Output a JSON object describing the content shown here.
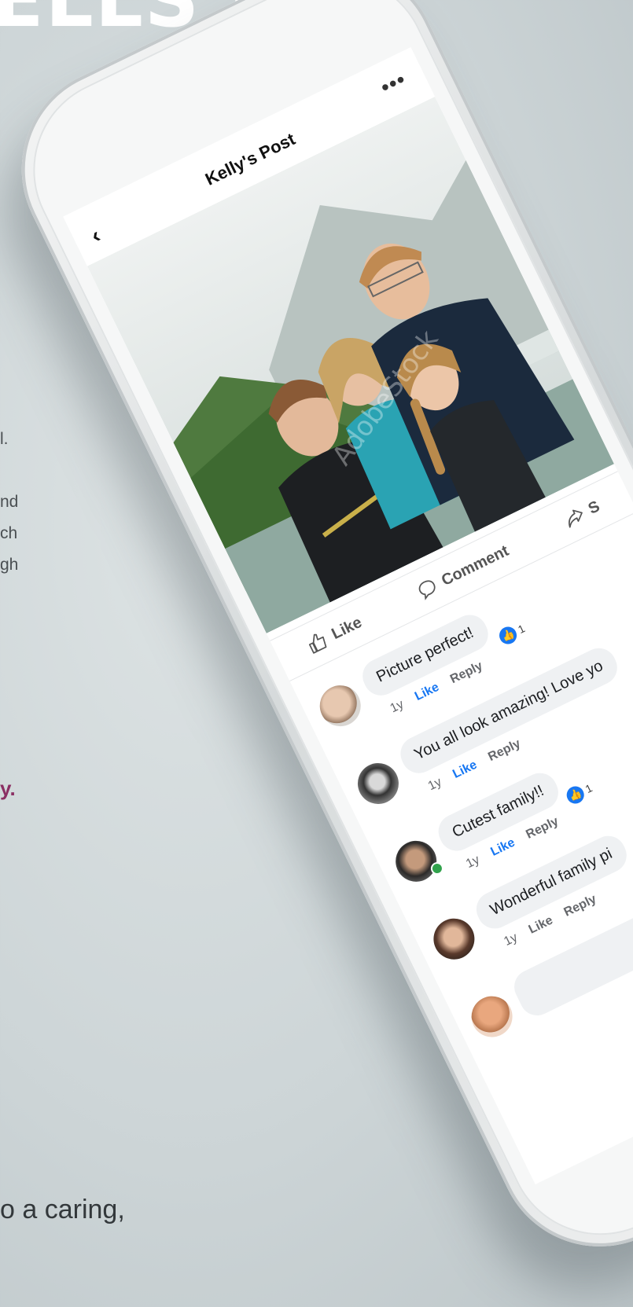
{
  "headline": "ELLS IT.",
  "side_text": [
    "l.",
    "nd",
    "ch",
    "gh"
  ],
  "side_accent": "y.",
  "bottom_text": "o a caring,",
  "post": {
    "title": "Kelly's Post",
    "back_icon": "chevron-left-icon",
    "more_label": "•••",
    "watermark": "AdobeStock"
  },
  "actions": {
    "like": "Like",
    "comment": "Comment",
    "share": "S"
  },
  "comments": [
    {
      "text": "Picture perfect!",
      "time": "1y",
      "like": "Like",
      "reply": "Reply",
      "liked": true,
      "reactions": "1"
    },
    {
      "text": "You all look amazing! Love yo",
      "time": "1y",
      "like": "Like",
      "reply": "Reply",
      "liked": true,
      "reactions": ""
    },
    {
      "text": "Cutest family!!",
      "time": "1y",
      "like": "Like",
      "reply": "Reply",
      "liked": true,
      "reactions": "1"
    },
    {
      "text": "Wonderful family pi",
      "time": "1y",
      "like": "Like",
      "reply": "Reply",
      "liked": false,
      "reactions": ""
    }
  ],
  "colors": {
    "accent": "#1877f2",
    "brand_text": "#8b2f63",
    "online": "#31a24c"
  }
}
